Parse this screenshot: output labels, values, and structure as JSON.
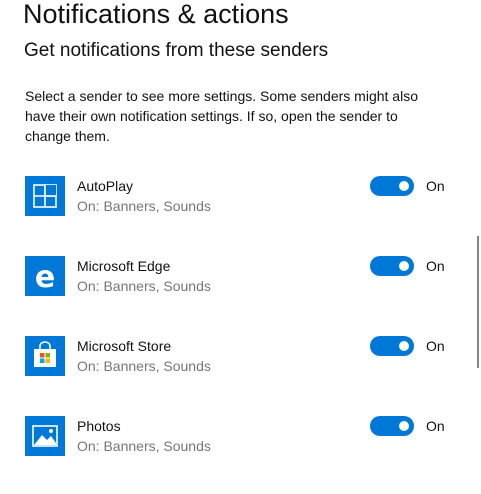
{
  "page": {
    "title": "Notifications & actions",
    "section_heading": "Get notifications from these senders",
    "description": "Select a sender to see more settings. Some senders might also have their own notification settings. If so, open the sender to change them."
  },
  "senders": [
    {
      "name": "AutoPlay",
      "status": "On: Banners, Sounds",
      "toggle_label": "On",
      "icon": "autoplay-icon",
      "enabled": true
    },
    {
      "name": "Microsoft Edge",
      "status": "On: Banners, Sounds",
      "toggle_label": "On",
      "icon": "edge-icon",
      "enabled": true
    },
    {
      "name": "Microsoft Store",
      "status": "On: Banners, Sounds",
      "toggle_label": "On",
      "icon": "store-icon",
      "enabled": true
    },
    {
      "name": "Photos",
      "status": "On: Banners, Sounds",
      "toggle_label": "On",
      "icon": "photos-icon",
      "enabled": true
    }
  ],
  "colors": {
    "accent": "#0078d7",
    "secondary_text": "#767676"
  }
}
